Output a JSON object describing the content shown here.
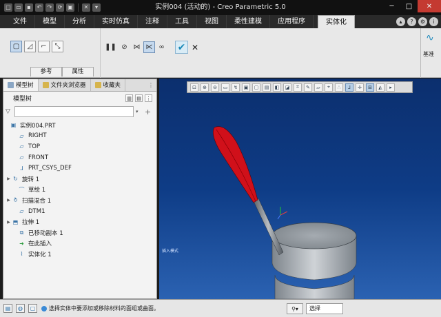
{
  "window": {
    "title": "实例004 (活动的) - Creo Parametric 5.0"
  },
  "menu_tabs": [
    {
      "label": "文件"
    },
    {
      "label": "模型"
    },
    {
      "label": "分析"
    },
    {
      "label": "实时仿真"
    },
    {
      "label": "注释"
    },
    {
      "label": "工具"
    },
    {
      "label": "视图"
    },
    {
      "label": "柔性建模"
    },
    {
      "label": "应用程序"
    },
    {
      "label": "实体化"
    }
  ],
  "ribbon": {
    "tabs": {
      "reference": "参考",
      "properties": "属性"
    },
    "base_label": "基准"
  },
  "model_tree": {
    "tabs": {
      "model_tree": "模型树",
      "file_browser": "文件夹浏览器",
      "favorites": "收藏夹"
    },
    "header": "模型树",
    "search_placeholder": "",
    "root": "实例004.PRT",
    "nodes": [
      {
        "label": "RIGHT",
        "icon": "datum-plane-icon"
      },
      {
        "label": "TOP",
        "icon": "datum-plane-icon"
      },
      {
        "label": "FRONT",
        "icon": "datum-plane-icon"
      },
      {
        "label": "PRT_CSYS_DEF",
        "icon": "csys-icon"
      },
      {
        "label": "旋转 1",
        "icon": "revolve-icon"
      },
      {
        "label": "草绘 1",
        "icon": "sketch-icon"
      },
      {
        "label": "扫描混合 1",
        "icon": "swept-blend-icon"
      },
      {
        "label": "DTM1",
        "icon": "datum-plane-icon"
      },
      {
        "label": "拉伸 1",
        "icon": "extrude-icon"
      },
      {
        "label": "已移动副本 1",
        "icon": "moved-copy-icon"
      },
      {
        "label": "在此插入",
        "icon": "insert-here-icon"
      },
      {
        "label": "实体化 1",
        "icon": "solidify-icon"
      }
    ]
  },
  "viewport": {
    "tiny_text": "插入模式"
  },
  "status": {
    "message": "选择实体中要添加或移除材料的面组或曲面。",
    "filter": "选择"
  }
}
